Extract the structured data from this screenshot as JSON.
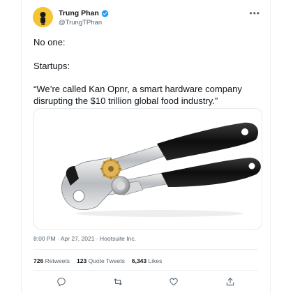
{
  "author": {
    "display_name": "Trung Phan",
    "handle": "@TrungTPhan"
  },
  "tweet": {
    "line1": "No one:",
    "line2": "Startups:",
    "line3": "“We’re called Kan Opnr, a smart hardware company disrupting  the $10 trillion global food industry.”"
  },
  "meta": {
    "time": "8:00 PM",
    "date": "Apr 27, 2021",
    "source": "Hootsuite Inc.",
    "separator": " · "
  },
  "stats": {
    "retweets_count": "726",
    "retweets_label": "Retweets",
    "quotes_count": "123",
    "quotes_label": "Quote Tweets",
    "likes_count": "6,343",
    "likes_label": "Likes"
  },
  "icons": {
    "more": "more-icon",
    "verified": "verified-badge-icon",
    "reply": "reply-icon",
    "retweet": "retweet-icon",
    "like": "like-icon",
    "share": "share-icon"
  },
  "colors": {
    "verified": "#1d9bf0",
    "avatar_bg": "#f4c531",
    "secondary_text": "#536471"
  }
}
